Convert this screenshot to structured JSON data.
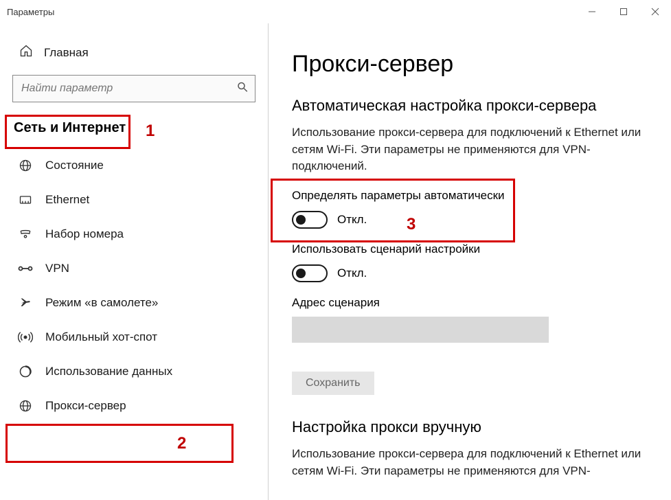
{
  "window": {
    "title": "Параметры"
  },
  "sidebar": {
    "home": "Главная",
    "search_placeholder": "Найти параметр",
    "section": "Сеть и Интернет",
    "items": [
      {
        "label": "Состояние",
        "icon": "globe-icon"
      },
      {
        "label": "Ethernet",
        "icon": "ethernet-icon"
      },
      {
        "label": "Набор номера",
        "icon": "dialup-icon"
      },
      {
        "label": "VPN",
        "icon": "vpn-icon"
      },
      {
        "label": "Режим «в самолете»",
        "icon": "airplane-icon"
      },
      {
        "label": "Мобильный хот-спот",
        "icon": "hotspot-icon"
      },
      {
        "label": "Использование данных",
        "icon": "data-usage-icon"
      },
      {
        "label": "Прокси-сервер",
        "icon": "proxy-icon"
      }
    ]
  },
  "main": {
    "title": "Прокси-сервер",
    "auto": {
      "heading": "Автоматическая настройка прокси-сервера",
      "desc": "Использование прокси-сервера для подключений к Ethernet или сетям Wi-Fi. Эти параметры не применяются для VPN-подключений.",
      "detect_label": "Определять параметры автоматически",
      "detect_state": "Откл.",
      "script_label": "Использовать сценарий настройки",
      "script_state": "Откл.",
      "script_url_label": "Адрес сценария",
      "script_url_value": "",
      "save_label": "Сохранить"
    },
    "manual": {
      "heading": "Настройка прокси вручную",
      "desc": "Использование прокси-сервера для подключений к Ethernet или сетям Wi-Fi. Эти параметры не применяются для VPN-"
    }
  },
  "annotations": {
    "n1": "1",
    "n2": "2",
    "n3": "3"
  }
}
